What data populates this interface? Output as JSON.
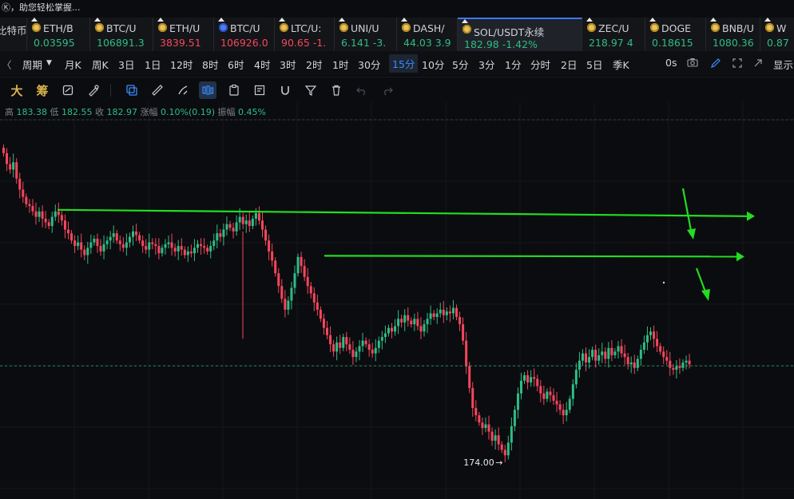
{
  "topbar": {
    "hint": "Ⓚ，助您轻松掌握..."
  },
  "tickers": [
    {
      "sym": "比特币",
      "price": "",
      "dir": "up",
      "coin": "none"
    },
    {
      "sym": "ETH/B",
      "price": "0.03595",
      "dir": "up",
      "coin": "gold"
    },
    {
      "sym": "BTC/U",
      "price": "106891.3",
      "dir": "up",
      "coin": "gold"
    },
    {
      "sym": "ETH/U",
      "price": "3839.51",
      "dir": "down",
      "coin": "gold"
    },
    {
      "sym": "BTC/U",
      "price": "106926.0",
      "dir": "down",
      "coin": "blue"
    },
    {
      "sym": "LTC/U:",
      "price": "90.65  -1.",
      "dir": "down",
      "coin": "gold"
    },
    {
      "sym": "UNI/U",
      "price": "6.141  -3.",
      "dir": "up",
      "coin": "gold"
    },
    {
      "sym": "DASH/",
      "price": "44.03  3.9",
      "dir": "up",
      "coin": "gold"
    },
    {
      "sym": "SOL/USDT永续",
      "price": "182.98  -1.42%",
      "dir": "up",
      "coin": "gold",
      "active": true
    },
    {
      "sym": "ZEC/U",
      "price": "218.97  4",
      "dir": "up",
      "coin": "gold"
    },
    {
      "sym": "DOGE",
      "price": "0.18615",
      "dir": "up",
      "coin": "gold"
    },
    {
      "sym": "BNB/U",
      "price": "1080.36",
      "dir": "up",
      "coin": "gold"
    },
    {
      "sym": "W",
      "price": "0.87",
      "dir": "up",
      "coin": "gold"
    }
  ],
  "periods": [
    "周期",
    "月K",
    "周K",
    "3日",
    "1日",
    "12时",
    "8时",
    "6时",
    "4时",
    "3时",
    "2时",
    "1时",
    "30分",
    "15分",
    "10分",
    "5分",
    "3分",
    "1分",
    "分时",
    "2日",
    "5日",
    "季K"
  ],
  "active_period": "15分",
  "period_extra": {
    "zero_s": "0s",
    "display": "显示"
  },
  "toolbar_text": {
    "da": "大",
    "chou": "筹"
  },
  "ohlc": {
    "high_label": "高",
    "high": "183.38",
    "low_label": "低",
    "low": "182.55",
    "close_label": "收",
    "close": "182.97",
    "change_label": "涨幅",
    "change": "0.10%(0.19)",
    "amp_label": "振幅",
    "amp": "0.45%"
  },
  "chart_data": {
    "type": "candlestick",
    "symbol": "SOL/USDT永续",
    "interval": "15分",
    "min_marker": "174.00",
    "colors": {
      "up": "#2ebd85",
      "down": "#f6465d",
      "annotation": "#22dd22"
    },
    "annotations": [
      {
        "kind": "horizontal-arrow",
        "price": 187.6
      },
      {
        "kind": "horizontal-arrow",
        "price": 185.6
      },
      {
        "kind": "pointer-arrow",
        "target_price": 187.6
      },
      {
        "kind": "pointer-arrow",
        "target_price": 185.6
      }
    ],
    "closes": [
      190.8,
      190.2,
      189.9,
      190.3,
      189.4,
      188.8,
      188.4,
      188.0,
      187.9,
      187.6,
      187.3,
      187.6,
      187.2,
      187.0,
      186.8,
      187.3,
      187.6,
      187.4,
      187.1,
      186.6,
      186.4,
      186.0,
      185.7,
      185.9,
      185.5,
      185.2,
      185.6,
      185.9,
      186.1,
      185.7,
      185.4,
      185.8,
      186.0,
      186.2,
      186.4,
      186.0,
      185.8,
      185.6,
      185.9,
      186.2,
      186.5,
      186.3,
      186.0,
      185.7,
      185.5,
      185.9,
      185.8,
      185.7,
      185.3,
      185.6,
      185.8,
      185.9,
      185.6,
      185.4,
      185.7,
      185.5,
      185.2,
      185.4,
      185.3,
      185.6,
      185.8,
      185.7,
      185.6,
      185.4,
      185.7,
      186.0,
      186.4,
      186.2,
      186.6,
      186.9,
      186.7,
      186.5,
      187.0,
      187.3,
      186.9,
      187.1,
      186.8,
      187.2,
      187.5,
      187.1,
      186.6,
      186.0,
      185.4,
      184.9,
      184.2,
      183.5,
      182.8,
      182.2,
      182.7,
      183.4,
      184.2,
      185.1,
      184.6,
      184.0,
      183.5,
      183.1,
      182.6,
      182.2,
      181.7,
      181.2,
      180.8,
      180.3,
      179.9,
      180.4,
      180.1,
      180.7,
      180.3,
      180.0,
      179.6,
      179.9,
      180.2,
      180.5,
      180.3,
      180.0,
      179.8,
      180.1,
      180.5,
      180.7,
      180.9,
      181.2,
      181.0,
      181.3,
      181.7,
      181.5,
      181.9,
      181.6,
      181.4,
      181.7,
      181.3,
      181.0,
      181.4,
      181.7,
      182.0,
      181.8,
      182.0,
      182.2,
      181.9,
      182.1,
      182.0,
      182.3,
      181.8,
      181.4,
      180.5,
      179.1,
      177.9,
      176.8,
      176.4,
      176.0,
      175.7,
      175.9,
      175.5,
      175.0,
      175.3,
      174.8,
      174.5,
      174.2,
      174.9,
      175.8,
      176.7,
      177.6,
      178.3,
      178.6,
      178.2,
      178.5,
      178.4,
      178.0,
      177.6,
      177.3,
      177.7,
      177.5,
      177.2,
      177.0,
      176.7,
      176.4,
      176.7,
      177.3,
      178.1,
      178.9,
      179.4,
      179.8,
      179.3,
      179.6,
      180.0,
      179.4,
      179.7,
      179.9,
      179.5,
      180.1,
      179.7,
      179.9,
      180.2,
      179.8,
      179.6,
      179.2,
      179.3,
      179.0,
      179.5,
      180.0,
      180.4,
      180.8,
      181.0,
      180.6,
      180.2,
      179.9,
      179.6,
      179.4,
      179.0,
      178.9,
      179.1,
      179.0,
      179.3,
      179.4,
      179.2
    ]
  }
}
